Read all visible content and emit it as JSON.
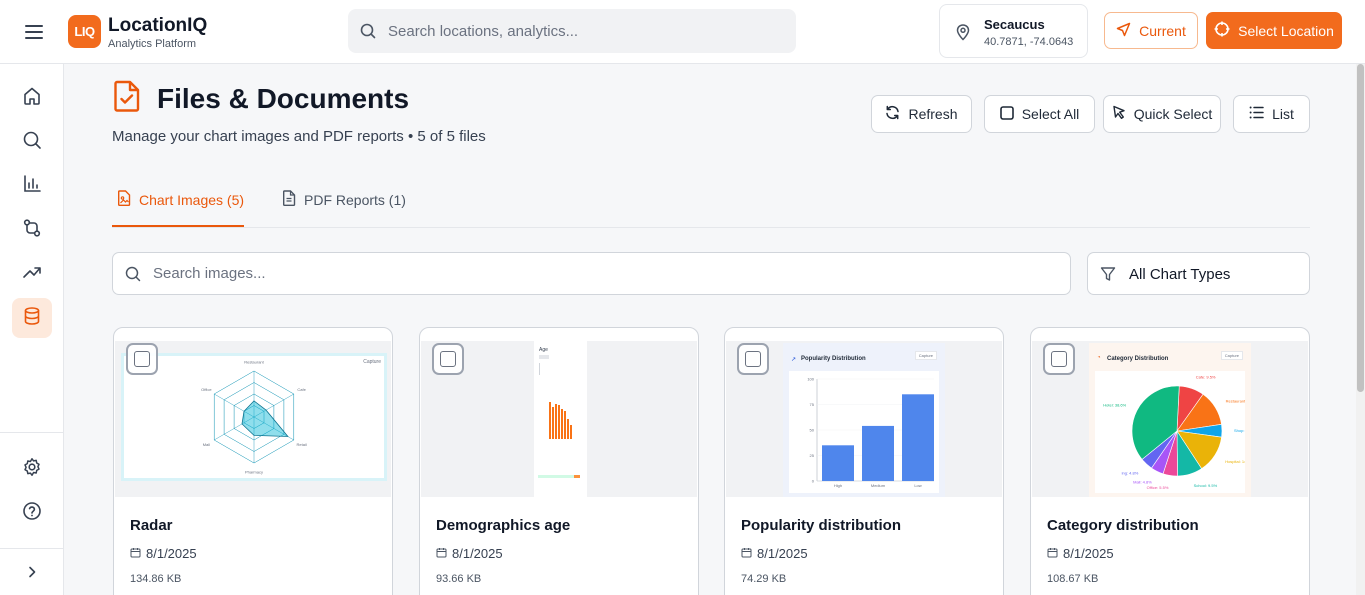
{
  "header": {
    "logo_text": "LIQ",
    "brand_name": "LocationIQ",
    "brand_subtitle": "Analytics Platform",
    "search_placeholder": "Search locations, analytics...",
    "location": {
      "name": "Secaucus",
      "coords": "40.7871, -74.0643"
    },
    "current_label": "Current",
    "select_location_label": "Select Location"
  },
  "sidebar": {
    "items": [
      {
        "name": "home-icon"
      },
      {
        "name": "search-icon"
      },
      {
        "name": "bar-chart-icon"
      },
      {
        "name": "route-icon"
      },
      {
        "name": "trending-up-icon"
      },
      {
        "name": "database-icon",
        "active": true
      }
    ],
    "bottom": [
      {
        "name": "settings-icon"
      },
      {
        "name": "help-icon"
      },
      {
        "name": "chevron-right-icon"
      }
    ]
  },
  "page": {
    "title": "Files & Documents",
    "subtitle": "Manage your chart images and PDF reports • 5 of 5 files",
    "toolbar": {
      "refresh": "Refresh",
      "select_all": "Select All",
      "quick_select": "Quick Select",
      "list": "List"
    },
    "tabs": [
      {
        "label": "Chart Images (5)",
        "active": true
      },
      {
        "label": "PDF Reports (1)",
        "active": false
      }
    ],
    "image_search_placeholder": "Search images...",
    "chart_type_filter": "All Chart Types"
  },
  "cards": [
    {
      "title": "Radar",
      "date": "8/1/2025",
      "size": "134.86 KB",
      "thumb": {
        "capture": "Capture",
        "axes": [
          "Restaurant",
          "Cafe",
          "Retail",
          "Pharmacy",
          "Mall",
          "Office"
        ]
      }
    },
    {
      "title": "Demographics age",
      "date": "8/1/2025",
      "size": "93.66 KB",
      "thumb": {
        "label": "Age"
      }
    },
    {
      "title": "Popularity distribution",
      "date": "8/1/2025",
      "size": "74.29 KB",
      "thumb": {
        "title": "Popularity Distribution",
        "capture": "Capture",
        "categories": [
          "High",
          "Medium",
          "Low"
        ],
        "values": [
          35,
          54,
          85
        ],
        "y_ticks": [
          "100",
          "75",
          "50",
          "25",
          "0"
        ]
      }
    },
    {
      "title": "Category distribution",
      "date": "8/1/2025",
      "size": "108.67 KB",
      "thumb": {
        "title": "Category Distribution",
        "capture": "Capture",
        "slices": [
          {
            "label": "Hotel: 38.6%",
            "value": 38.6,
            "color": "#10b981"
          },
          {
            "label": "Cafe: 9.5%",
            "value": 9.5,
            "color": "#ef4444"
          },
          {
            "label": "Restaurant",
            "value": 13.5,
            "color": "#f97316"
          },
          {
            "label": "Shop: 4.8",
            "value": 4.8,
            "color": "#0ea5e9"
          },
          {
            "label": "Hospital: 14.3",
            "value": 14.3,
            "color": "#eab308"
          },
          {
            "label": "School: 9.5%",
            "value": 9.5,
            "color": "#14b8a6"
          },
          {
            "label": "Office: 5.5%",
            "value": 5.5,
            "color": "#ec4899"
          },
          {
            "label": "Mall: 4.8%",
            "value": 4.8,
            "color": "#a855f7"
          },
          {
            "label": "ing: 4.8%",
            "value": 4.8,
            "color": "#6366f1"
          }
        ]
      }
    }
  ],
  "colors": {
    "accent": "#f26b1d",
    "accent_text": "#ea580c"
  }
}
